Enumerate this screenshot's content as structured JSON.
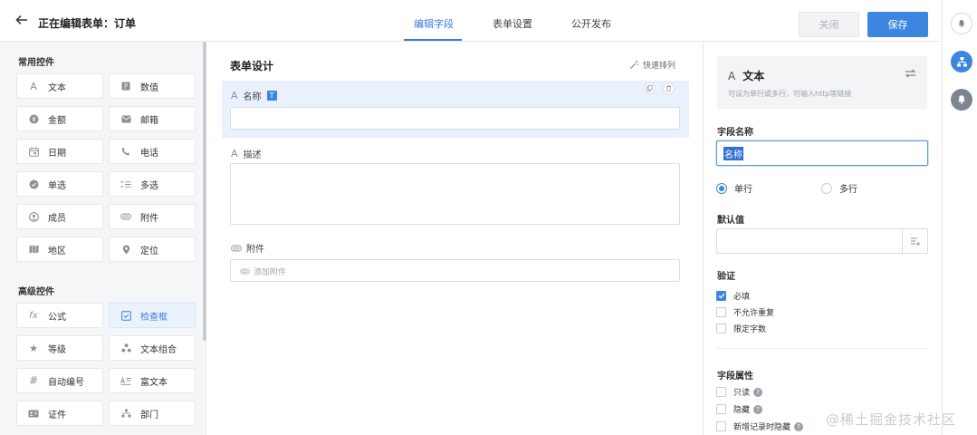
{
  "header": {
    "title": "正在编辑表单：订单",
    "tabs": [
      {
        "label": "编辑字段"
      },
      {
        "label": "表单设置"
      },
      {
        "label": "公开发布"
      }
    ],
    "close_label": "关闭",
    "save_label": "保存"
  },
  "palette": {
    "common_title": "常用控件",
    "common": [
      {
        "label": "文本",
        "icon": "text-icon"
      },
      {
        "label": "数值",
        "icon": "number-icon"
      },
      {
        "label": "金额",
        "icon": "currency-icon"
      },
      {
        "label": "邮箱",
        "icon": "mail-icon"
      },
      {
        "label": "日期",
        "icon": "calendar-icon"
      },
      {
        "label": "电话",
        "icon": "phone-icon"
      },
      {
        "label": "单选",
        "icon": "radio-icon"
      },
      {
        "label": "多选",
        "icon": "multi-select-icon"
      },
      {
        "label": "成员",
        "icon": "user-icon"
      },
      {
        "label": "附件",
        "icon": "paperclip-icon"
      },
      {
        "label": "地区",
        "icon": "map-icon"
      },
      {
        "label": "定位",
        "icon": "location-pin-icon"
      }
    ],
    "advanced_title": "高级控件",
    "advanced": [
      {
        "label": "公式",
        "icon": "formula-icon"
      },
      {
        "label": "检查框",
        "icon": "checkbox-icon",
        "selected": true
      },
      {
        "label": "等级",
        "icon": "star-icon"
      },
      {
        "label": "文本组合",
        "icon": "text-combo-icon"
      },
      {
        "label": "自动编号",
        "icon": "hash-icon"
      },
      {
        "label": "富文本",
        "icon": "rich-text-icon"
      },
      {
        "label": "证件",
        "icon": "id-card-icon"
      },
      {
        "label": "部门",
        "icon": "department-icon"
      }
    ]
  },
  "canvas": {
    "title": "表单设计",
    "arrange_label": "快速排列",
    "fields": [
      {
        "label": "名称",
        "badge": "T"
      },
      {
        "label": "描述"
      },
      {
        "label": "附件",
        "placeholder": "添加附件"
      }
    ]
  },
  "props": {
    "type_title": "文本",
    "type_desc": "可设为单行或多行，可输入http等链接",
    "field_name_label": "字段名称",
    "field_name_value": "名称",
    "radio_single": "单行",
    "radio_multi": "多行",
    "default_label": "默认值",
    "validation_label": "验证",
    "validation": [
      {
        "label": "必填",
        "checked": true
      },
      {
        "label": "不允许重复",
        "checked": false
      },
      {
        "label": "限定字数",
        "checked": false
      }
    ],
    "attrs_label": "字段属性",
    "attrs": [
      {
        "label": "只读",
        "help": true
      },
      {
        "label": "隐藏",
        "help": true
      },
      {
        "label": "新增记录时隐藏",
        "help": true
      }
    ]
  },
  "watermark": "@稀土掘金技术社区",
  "colors": {
    "accent": "#3d86e0",
    "selected_bg": "#e9f1fc"
  }
}
